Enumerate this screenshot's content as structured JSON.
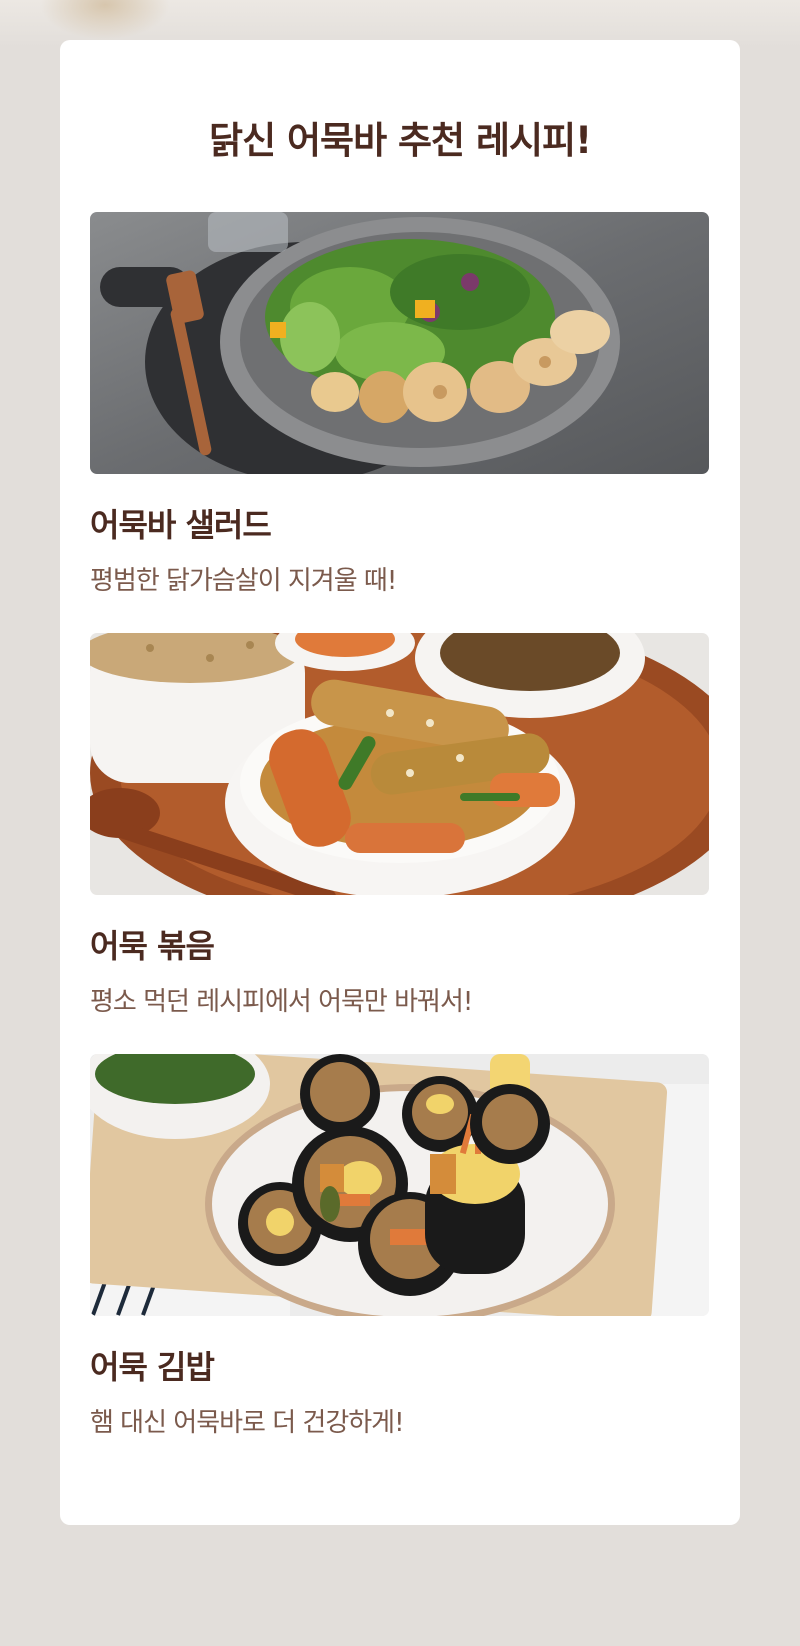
{
  "section": {
    "title": "닭신 어묵바 추천 레시피!"
  },
  "recipes": [
    {
      "name": "어묵바 샐러드",
      "description": "평범한 닭가슴살이 지겨울 때!",
      "image_icon": "salad-photo"
    },
    {
      "name": "어묵 볶음",
      "description": "평소 먹던 레시피에서 어묵만 바꿔서!",
      "image_icon": "stir-fry-photo"
    },
    {
      "name": "어묵 김밥",
      "description": "햄 대신 어묵바로 더 건강하게!",
      "image_icon": "gimbap-photo"
    }
  ],
  "colors": {
    "background": "#e2deda",
    "card": "#ffffff",
    "heading": "#4b2a20",
    "subtext": "#7b5a4c"
  }
}
